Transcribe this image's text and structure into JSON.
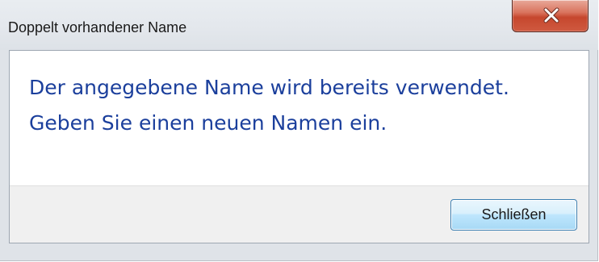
{
  "dialog": {
    "title": "Doppelt vorhandener Name",
    "message_lines": [
      "Der angegebene Name wird bereits verwendet.",
      "Geben Sie einen neuen Namen ein."
    ],
    "close_button_icon": "close-x-icon",
    "close_button_label": "Schließen"
  },
  "colors": {
    "message_text": "#1b3f9c",
    "close_button": "#c6472e",
    "default_button_border": "#3c7fb1",
    "window_frame": "#dfe3e8",
    "footer": "#f0f0f0"
  }
}
